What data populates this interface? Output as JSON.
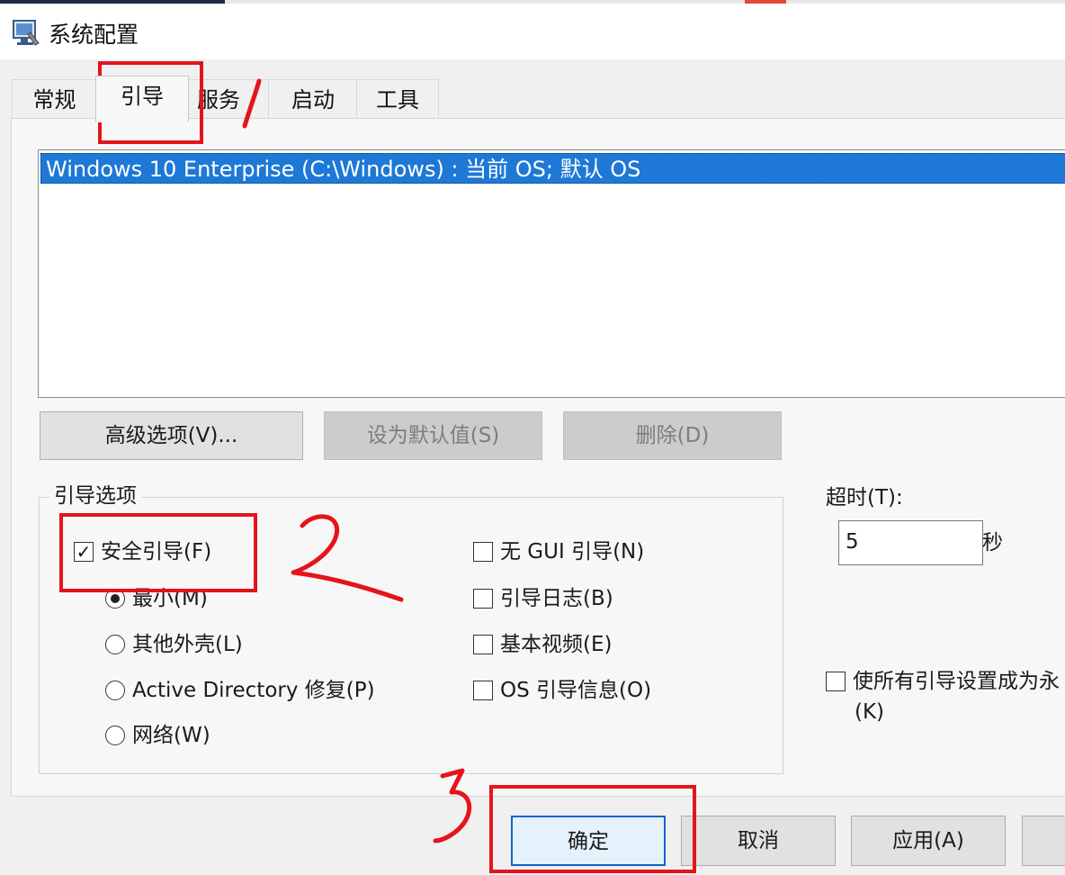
{
  "window": {
    "title": "系统配置",
    "icon": "msconfig-window-icon"
  },
  "tabs": [
    {
      "label": "常规",
      "selected": false
    },
    {
      "label": "引导",
      "selected": true
    },
    {
      "label": "服务",
      "selected": false
    },
    {
      "label": "启动",
      "selected": false
    },
    {
      "label": "工具",
      "selected": false
    }
  ],
  "os_list": {
    "items": [
      {
        "label": "Windows 10 Enterprise (C:\\Windows) : 当前 OS; 默认 OS",
        "selected": true
      }
    ]
  },
  "actions": {
    "advanced_label": "高级选项(V)...",
    "set_default_label": "设为默认值(S)",
    "delete_label": "删除(D)"
  },
  "boot_options": {
    "title": "引导选项",
    "safe_boot": {
      "label": "安全引导(F)",
      "checked": true
    },
    "radios": [
      {
        "label": "最小(M)",
        "selected": true
      },
      {
        "label": "其他外壳(L)",
        "selected": false
      },
      {
        "label": "Active Directory 修复(P)",
        "selected": false
      },
      {
        "label": "网络(W)",
        "selected": false
      }
    ],
    "checkboxes": [
      {
        "label": "无 GUI 引导(N)",
        "checked": false
      },
      {
        "label": "引导日志(B)",
        "checked": false
      },
      {
        "label": "基本视频(E)",
        "checked": false
      },
      {
        "label": "OS 引导信息(O)",
        "checked": false
      }
    ]
  },
  "timeout": {
    "label": "超时(T):",
    "value": "5",
    "unit": "秒"
  },
  "permanent": {
    "label_line1": "使所有引导设置成为永",
    "label_line2": "(K)",
    "checked": false
  },
  "footer": {
    "ok_label": "确定",
    "cancel_label": "取消",
    "apply_label": "应用(A)",
    "help_label": ""
  },
  "annotations": {
    "color": "#e5141b",
    "step_marks": [
      "1",
      "2",
      "3"
    ]
  }
}
